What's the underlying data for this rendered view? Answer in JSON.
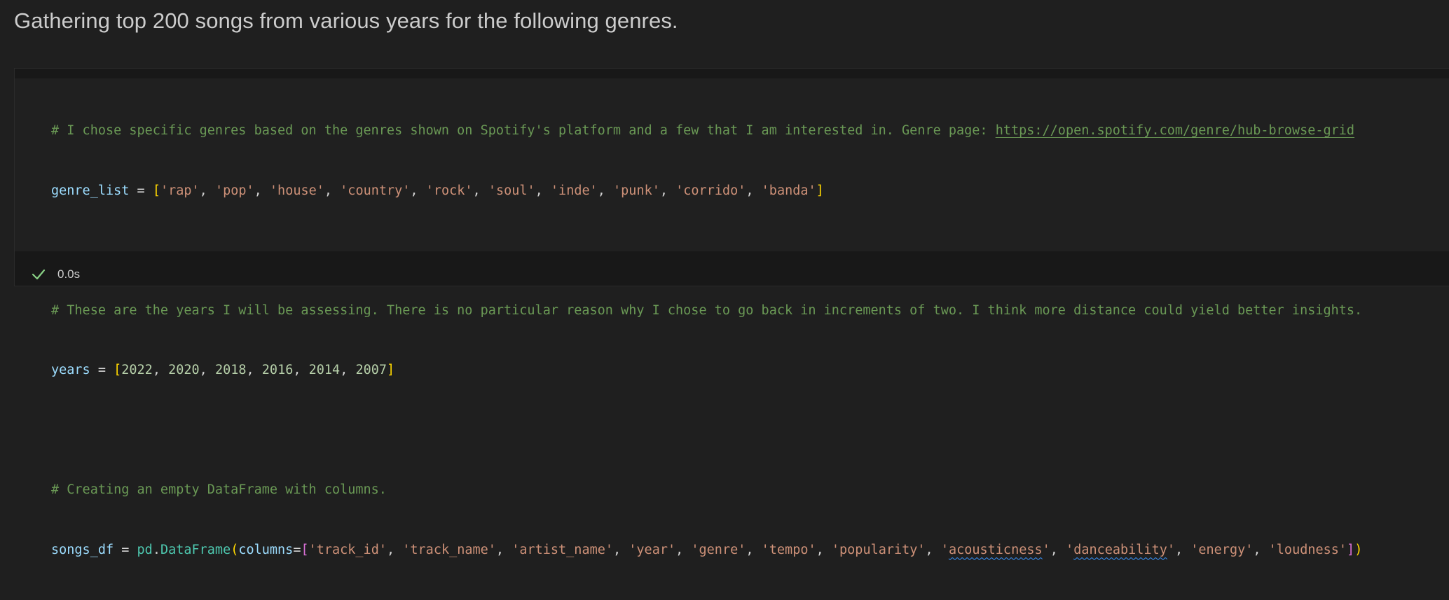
{
  "markdown": {
    "heading": "Gathering top 200 songs from various years for the following genres."
  },
  "code": {
    "comment1": "# I chose specific genres based on the genres shown on Spotify's platform and a few that I am interested in. Genre page: ",
    "comment1_link": "https://open.spotify.com/genre/hub-browse-grid",
    "genre_var": "genre_list",
    "genres": [
      "'rap'",
      "'pop'",
      "'house'",
      "'country'",
      "'rock'",
      "'soul'",
      "'inde'",
      "'punk'",
      "'corrido'",
      "'banda'"
    ],
    "comment2": "# These are the years I will be assessing. There is no particular reason why I chose to go back in increments of two. I think more distance could yield better insights.",
    "years_var": "years",
    "years": [
      "2022",
      "2020",
      "2018",
      "2016",
      "2014",
      "2007"
    ],
    "comment3": "# Creating an empty DataFrame with columns.",
    "df_var": "songs_df",
    "module": "pd",
    "class_name": "DataFrame",
    "kwarg": "columns",
    "columns": [
      "'track_id'",
      "'track_name'",
      "'artist_name'",
      "'year'",
      "'genre'",
      "'tempo'",
      "'popularity'",
      "'acousticness'",
      "'danceability'",
      "'energy'",
      "'loudness'"
    ]
  },
  "status": {
    "exec_count": "]",
    "duration": "0.0s",
    "success_color": "#89d185",
    "icon": "check-icon"
  }
}
